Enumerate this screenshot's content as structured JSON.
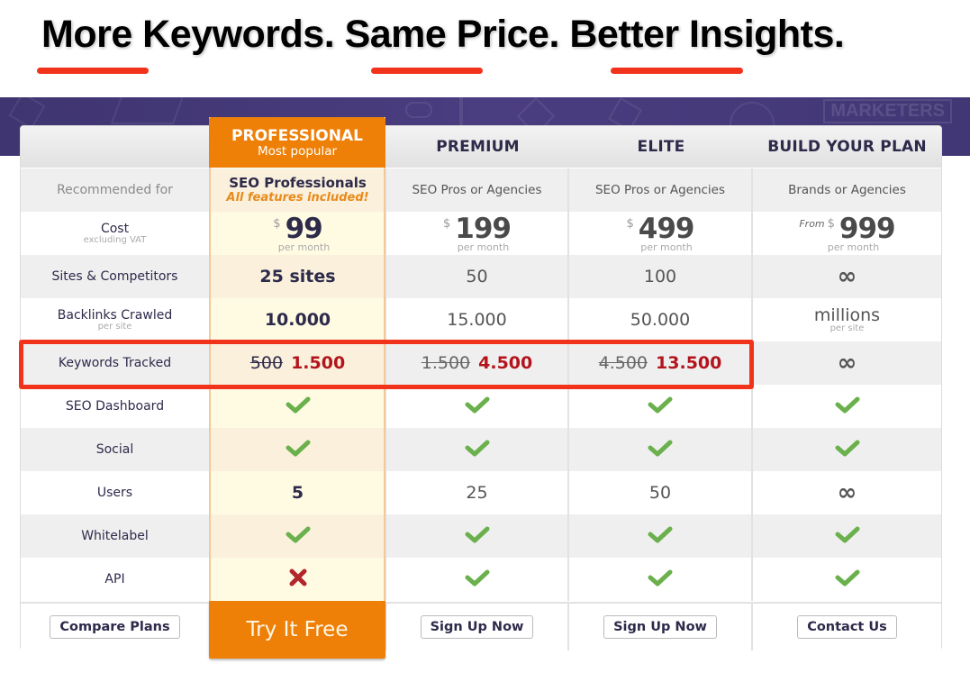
{
  "headline": {
    "text": "More Keywords. Same Price. Better Insights.",
    "accent_color": "#f2331c"
  },
  "banner": {
    "watermark": "MARKETERS"
  },
  "plans": [
    {
      "name": "PROFESSIONAL",
      "subtitle": "Most popular",
      "highlighted": true
    },
    {
      "name": "PREMIUM"
    },
    {
      "name": "ELITE"
    },
    {
      "name": "BUILD YOUR PLAN"
    }
  ],
  "rows": {
    "recommended": {
      "label": "Recommended for",
      "values": [
        "SEO Professionals",
        "SEO Pros or Agencies",
        "SEO Pros or Agencies",
        "Brands or Agencies"
      ],
      "pro_note": "All features included!"
    },
    "cost": {
      "label": "Cost",
      "sublabel": "excluding VAT",
      "currency": "$",
      "from_label": "From",
      "period": "per month",
      "values": [
        "99",
        "199",
        "499",
        "999"
      ]
    },
    "sites": {
      "label": "Sites & Competitors",
      "values": [
        "25 sites",
        "50",
        "100",
        "∞"
      ]
    },
    "backlinks": {
      "label": "Backlinks Crawled",
      "sublabel": "per site",
      "values": [
        "10.000",
        "15.000",
        "50.000",
        "millions"
      ],
      "last_sub": "per site"
    },
    "keywords": {
      "label": "Keywords Tracked",
      "old_values": [
        "500",
        "1.500",
        "4.500"
      ],
      "new_values": [
        "1.500",
        "4.500",
        "13.500"
      ],
      "last": "∞"
    },
    "seo_dashboard": {
      "label": "SEO Dashboard",
      "values": [
        "check",
        "check",
        "check",
        "check"
      ]
    },
    "social": {
      "label": "Social",
      "values": [
        "check",
        "check",
        "check",
        "check"
      ]
    },
    "users": {
      "label": "Users",
      "values": [
        "5",
        "25",
        "50",
        "∞"
      ]
    },
    "whitelabel": {
      "label": "Whitelabel",
      "values": [
        "check",
        "check",
        "check",
        "check"
      ]
    },
    "api": {
      "label": "API",
      "values": [
        "cross",
        "check",
        "check",
        "check"
      ]
    }
  },
  "buttons": {
    "compare": "Compare Plans",
    "try_free": "Try It Free",
    "premium": "Sign Up Now",
    "elite": "Sign Up Now",
    "build": "Contact Us"
  },
  "colors": {
    "brand_orange": "#ee8008",
    "check_green": "#6ab04c",
    "cross_red": "#b3262b",
    "new_value_red": "#b3141c",
    "banner_purple": "#463a7a"
  }
}
